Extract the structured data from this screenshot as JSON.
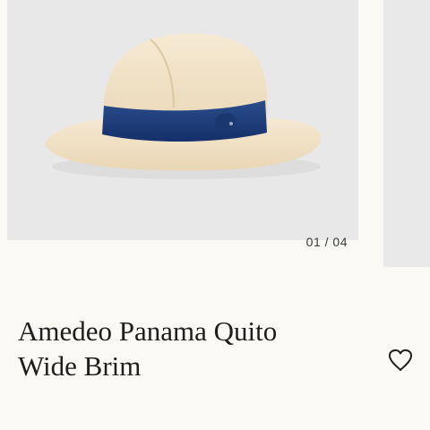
{
  "carousel": {
    "counter": "01 / 04",
    "image_icon": "panama-hat-image"
  },
  "product": {
    "title_line1": "Amedeo Panama Quito",
    "title_line2": "Wide Brim"
  },
  "wishlist": {
    "icon": "heart-outline-icon"
  },
  "colors": {
    "background": "#fbf9f6",
    "image_bg": "#e8e8e8",
    "straw": "#f1e2c6",
    "band": "#1f3f7a",
    "text": "#1e1e1e"
  }
}
